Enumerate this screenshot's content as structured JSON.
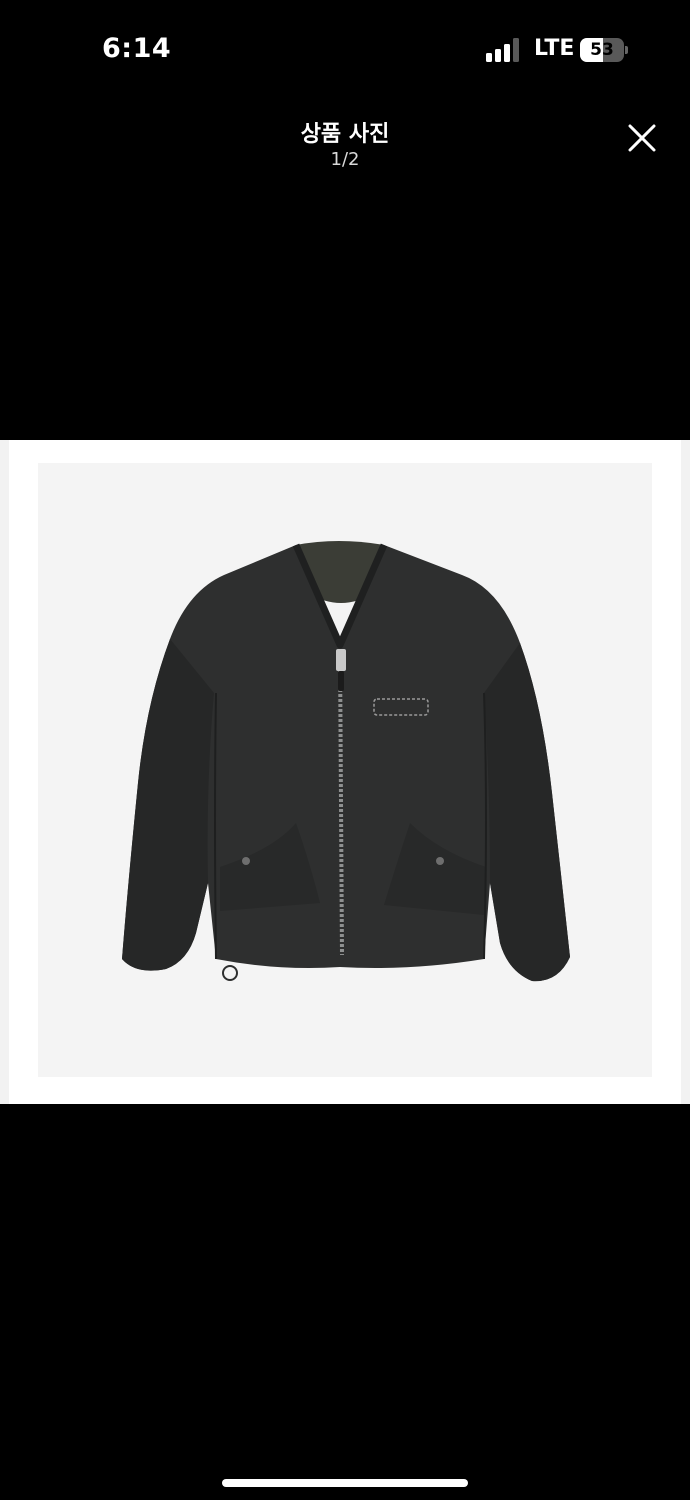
{
  "status_bar": {
    "time": "6:14",
    "network": "LTE",
    "battery_percent": "53",
    "battery_level": 0.53,
    "signal_bars_active": 3,
    "signal_bars_total": 4
  },
  "header": {
    "title": "상품 사진",
    "counter": "1/2",
    "close_icon": "close-icon"
  },
  "photo": {
    "subject_icon": "product-photo-jacket",
    "background_color": "#f4f4f4",
    "jacket_color": "#2e2f2f"
  },
  "home_indicator": "home-indicator"
}
